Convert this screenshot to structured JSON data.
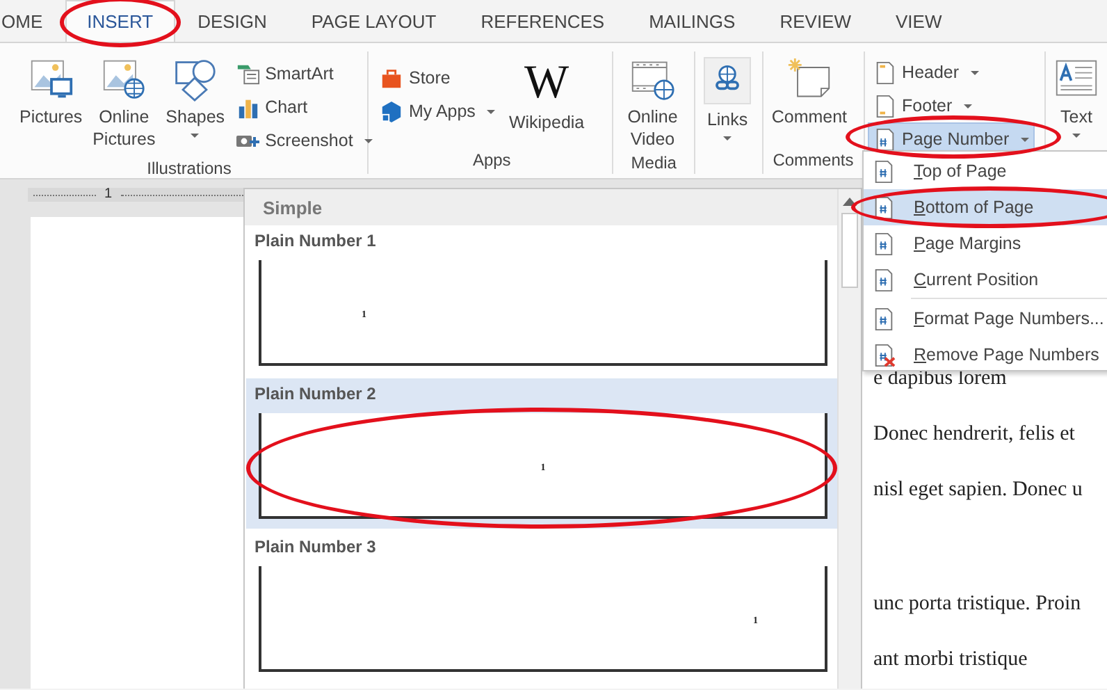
{
  "tabs": [
    {
      "label": "OME",
      "selected": false,
      "circled": false
    },
    {
      "label": "INSERT",
      "selected": true,
      "circled": true
    },
    {
      "label": "DESIGN",
      "selected": false,
      "circled": false
    },
    {
      "label": "PAGE LAYOUT",
      "selected": false,
      "circled": false
    },
    {
      "label": "REFERENCES",
      "selected": false,
      "circled": false
    },
    {
      "label": "MAILINGS",
      "selected": false,
      "circled": false
    },
    {
      "label": "REVIEW",
      "selected": false,
      "circled": false
    },
    {
      "label": "VIEW",
      "selected": false,
      "circled": false
    }
  ],
  "ribbon": {
    "groups": [
      {
        "label": "Illustrations",
        "commands": [
          {
            "label": "Pictures"
          },
          {
            "label": "Online Pictures"
          },
          {
            "label": "Shapes",
            "has_menu": true
          },
          {
            "label": "SmartArt"
          },
          {
            "label": "Chart"
          },
          {
            "label": "Screenshot",
            "has_menu": true
          }
        ]
      },
      {
        "label": "Apps",
        "commands": [
          {
            "label": "Store"
          },
          {
            "label": "My Apps",
            "has_menu": true
          },
          {
            "label": "Wikipedia",
            "logo_text": "W"
          }
        ]
      },
      {
        "label": "Media",
        "commands": [
          {
            "label": "Online Video"
          }
        ]
      },
      {
        "commands": [
          {
            "label": "Links",
            "has_menu": true
          }
        ]
      },
      {
        "label": "Comments",
        "commands": [
          {
            "label": "Comment"
          }
        ]
      },
      {
        "commands": [
          {
            "label": "Header",
            "has_menu": true,
            "expanded": false
          },
          {
            "label": "Footer",
            "has_menu": true,
            "expanded": false
          },
          {
            "label": "Page Number",
            "has_menu": true,
            "expanded": true,
            "circled": true
          }
        ]
      },
      {
        "commands": [
          {
            "label": "Text",
            "has_menu": true
          }
        ]
      }
    ]
  },
  "ruler": {
    "labels": [
      "1"
    ]
  },
  "document": {
    "paragraphs": [
      {
        "text": "e dapibus lorem",
        "space_before": false
      },
      {
        "text": "Donec hendrerit, felis et",
        "space_before": false
      },
      {
        "text": "nisl eget sapien. Donec u",
        "space_before": false
      },
      {
        "text": "unc porta tristique. Proin",
        "space_before": true
      },
      {
        "text": "ant morbi tristique",
        "space_before": false
      }
    ]
  },
  "gallery": {
    "section": "Simple",
    "items": [
      {
        "label": "Plain Number 1",
        "page_number": "1",
        "kind": "left",
        "selected": false
      },
      {
        "label": "Plain Number 2",
        "page_number": "1",
        "kind": "center",
        "selected": true,
        "circled": true
      },
      {
        "label": "Plain Number 3",
        "page_number": "1",
        "kind": "right",
        "selected": false
      }
    ]
  },
  "page_number_menu": {
    "sections": [
      [
        {
          "label": "Top of Page",
          "selected": false
        },
        {
          "label": "Bottom of Page",
          "selected": true,
          "circled": true
        },
        {
          "label": "Page Margins",
          "selected": false
        },
        {
          "label": "Current Position",
          "selected": false
        }
      ],
      [
        {
          "label": "Format Page Numbers...",
          "selected": false
        },
        {
          "label": "Remove Page Numbers",
          "selected": false
        }
      ]
    ]
  }
}
